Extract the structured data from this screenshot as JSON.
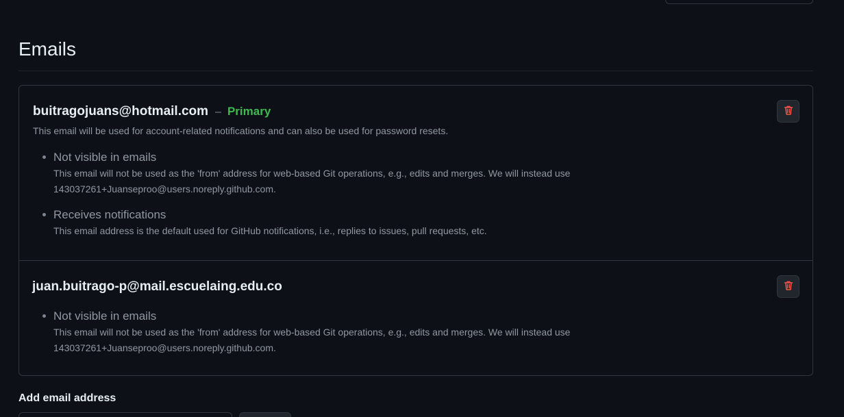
{
  "section": {
    "title": "Emails"
  },
  "emails": [
    {
      "address": "buitragojuans@hotmail.com",
      "separator": "–",
      "badge": "Primary",
      "description": "This email will be used for account-related notifications and can also be used for password resets.",
      "properties": [
        {
          "title": "Not visible in emails",
          "description": "This email will not be used as the 'from' address for web-based Git operations, e.g., edits and merges. We will instead use 143037261+Juanseproo@users.noreply.github.com."
        },
        {
          "title": "Receives notifications",
          "description": "This email address is the default used for GitHub notifications, i.e., replies to issues, pull requests, etc."
        }
      ],
      "delete_icon": "trash-icon"
    },
    {
      "address": "juan.buitrago-p@mail.escuelaing.edu.co",
      "properties": [
        {
          "title": "Not visible in emails",
          "description": "This email will not be used as the 'from' address for web-based Git operations, e.g., edits and merges. We will instead use 143037261+Juanseproo@users.noreply.github.com."
        }
      ],
      "delete_icon": "trash-icon"
    }
  ],
  "add_email": {
    "title": "Add email address"
  },
  "colors": {
    "background": "#0d1117",
    "border": "#30363d",
    "primary_badge": "#3fb950",
    "danger": "#f85149",
    "muted_text": "#9198a1"
  }
}
